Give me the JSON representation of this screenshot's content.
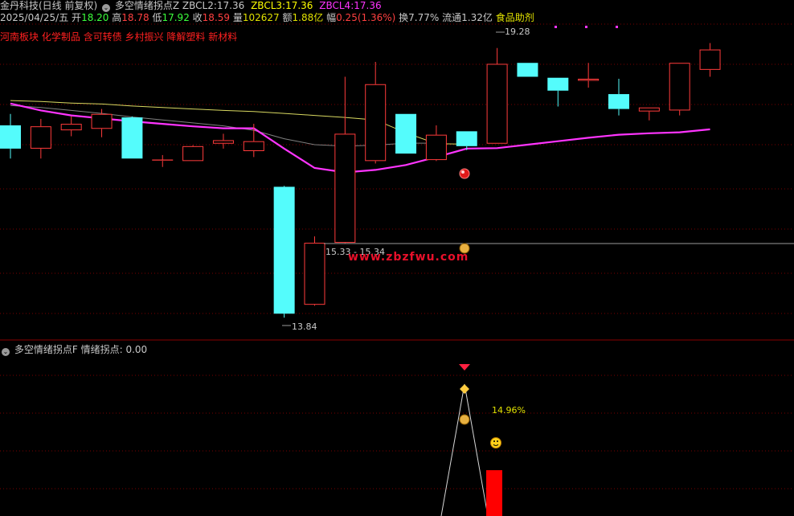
{
  "header": {
    "stock": "金丹科技(日线 前复权)",
    "indicator": "多空情绪拐点Z",
    "zbcl2_label": "ZBCL2:",
    "zbcl2_value": "17.36",
    "zbcl3_label": "ZBCL3:",
    "zbcl3_value": "17.36",
    "zbcl4_label": "ZBCL4:",
    "zbcl4_value": "17.36"
  },
  "quote": {
    "date": "2025/04/25/五",
    "open_label": "开",
    "open": "18.20",
    "high_label": "高",
    "high": "18.78",
    "low_label": "低",
    "low": "17.92",
    "close_label": "收",
    "close": "18.59",
    "volume_label": "量",
    "volume": "102627",
    "amount_label": "额",
    "amount": "1.88亿",
    "change_label": "幅",
    "change": "0.25(1.36%)",
    "turnover_label": "换",
    "turnover": "7.77%",
    "float_label": "流通",
    "float": "1.32亿",
    "sector": "食品助剂"
  },
  "concepts": [
    "河南板块",
    "化学制品",
    "含可转债",
    "乡村振兴",
    "降解塑料",
    "新材料"
  ],
  "annotations": {
    "high_mark": "19.28",
    "low_mark": "13.84",
    "range_mark": "15.33 - 15.34",
    "pct_mark": "14.96%"
  },
  "watermark": "www.zbzfwu.com",
  "sub_panel": {
    "indicator": "多空情绪拐点F",
    "label": "情绪拐点:",
    "value": "0.00"
  },
  "colors": {
    "up": "#ff3b3b",
    "down": "#54fcfc",
    "ma_magenta": "#ff34ff",
    "ma_yellow": "#d8d860",
    "ma_gray": "#808080",
    "grid": "#7a0000"
  },
  "chart_data": {
    "type": "candlestick",
    "price_range": [
      13.4,
      19.6
    ],
    "candles": [
      {
        "o": 17.72,
        "c": 17.25,
        "h": 17.95,
        "l": 17.05
      },
      {
        "o": 17.25,
        "c": 17.7,
        "h": 17.85,
        "l": 17.05
      },
      {
        "o": 17.62,
        "c": 17.75,
        "h": 17.9,
        "l": 17.5
      },
      {
        "o": 17.65,
        "c": 17.95,
        "h": 18.05,
        "l": 17.48
      },
      {
        "o": 17.88,
        "c": 17.05,
        "h": 17.9,
        "l": 17.05
      },
      {
        "o": 17.02,
        "c": 17.02,
        "h": 17.12,
        "l": 16.88
      },
      {
        "o": 17.0,
        "c": 17.3,
        "h": 17.32,
        "l": 17.0
      },
      {
        "o": 17.35,
        "c": 17.42,
        "h": 17.55,
        "l": 17.25
      },
      {
        "o": 17.2,
        "c": 17.4,
        "h": 17.75,
        "l": 17.08
      },
      {
        "o": 16.48,
        "c": 13.92,
        "h": 16.5,
        "l": 13.84
      },
      {
        "o": 14.1,
        "c": 15.35,
        "h": 15.48,
        "l": 14.08
      },
      {
        "o": 15.35,
        "c": 17.55,
        "h": 18.7,
        "l": 15.33
      },
      {
        "o": 17.0,
        "c": 18.55,
        "h": 19.0,
        "l": 16.95
      },
      {
        "o": 17.95,
        "c": 17.15,
        "h": 17.95,
        "l": 17.15
      },
      {
        "o": 17.02,
        "c": 17.53,
        "h": 17.72,
        "l": 17.0
      },
      {
        "o": 17.6,
        "c": 17.3,
        "h": 17.6,
        "l": 17.22
      },
      {
        "o": 17.35,
        "c": 18.96,
        "h": 19.28,
        "l": 17.35
      },
      {
        "o": 18.98,
        "c": 18.7,
        "h": 18.98,
        "l": 18.7
      },
      {
        "o": 18.68,
        "c": 18.42,
        "h": 18.68,
        "l": 18.1
      },
      {
        "o": 18.62,
        "c": 18.66,
        "h": 18.98,
        "l": 18.48
      },
      {
        "o": 18.35,
        "c": 18.05,
        "h": 18.66,
        "l": 17.92
      },
      {
        "o": 18.0,
        "c": 18.08,
        "h": 18.08,
        "l": 17.82
      },
      {
        "o": 18.02,
        "c": 18.98,
        "h": 18.98,
        "l": 17.92
      },
      {
        "o": 18.84,
        "c": 19.25,
        "h": 19.38,
        "l": 18.7
      }
    ],
    "ma_magenta": [
      18.16,
      18.02,
      17.92,
      17.86,
      17.8,
      17.75,
      17.7,
      17.66,
      17.66,
      17.25,
      16.86,
      16.77,
      16.82,
      16.92,
      17.08,
      17.25,
      17.26,
      17.33,
      17.4,
      17.47,
      17.53,
      17.56,
      17.58,
      17.64
    ],
    "ma_yellow": [
      18.22,
      18.2,
      18.17,
      18.15,
      18.11,
      18.08,
      18.05,
      18.02,
      18.0,
      17.96,
      17.92,
      17.88,
      17.83,
      17.57,
      17.35,
      17.34
    ],
    "ma_gray": [
      18.12,
      18.08,
      18.02,
      17.96,
      17.89,
      17.83,
      17.77,
      17.71,
      17.62,
      17.45,
      17.33,
      17.3,
      17.32,
      17.36,
      17.36
    ]
  }
}
